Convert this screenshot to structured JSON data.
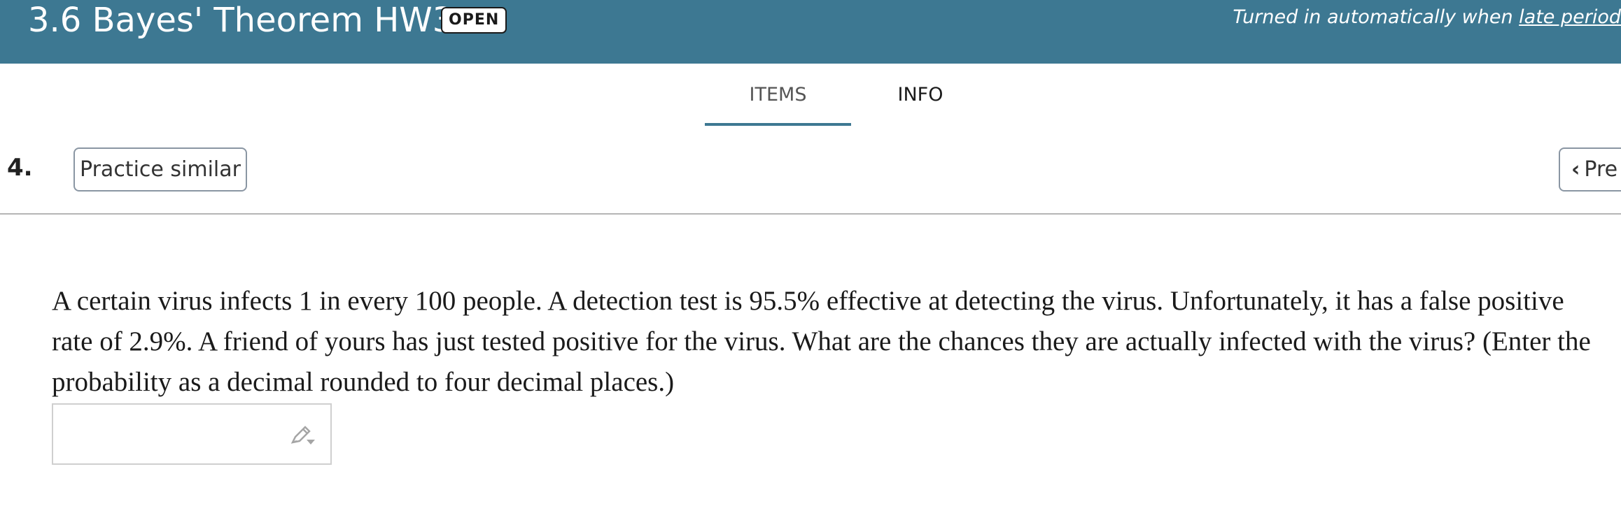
{
  "header": {
    "title": "3.6 Bayes' Theorem HW3",
    "badge": "OPEN",
    "turned_in_text": "Turned in automatically when ",
    "turned_in_link": "late period",
    "bg_color": "#3d7892"
  },
  "tabs": [
    {
      "label": "ITEMS",
      "active": true
    },
    {
      "label": "INFO",
      "active": false
    }
  ],
  "question": {
    "number": "4.",
    "practice_label": "Practice similar",
    "prev_label": "Pre",
    "text": "A certain virus infects 1 in every 100 people. A detection test is 95.5% effective at detecting the virus. Unfortunately, it has a false positive rate of 2.9%. A friend of yours has just tested positive for the virus. What are the chances they are actually infected with the virus? (Enter the probability as a decimal rounded to four decimal places.)",
    "answer_value": ""
  },
  "icons": {
    "prev": "chevron-left-icon",
    "edit": "pencil-icon"
  }
}
